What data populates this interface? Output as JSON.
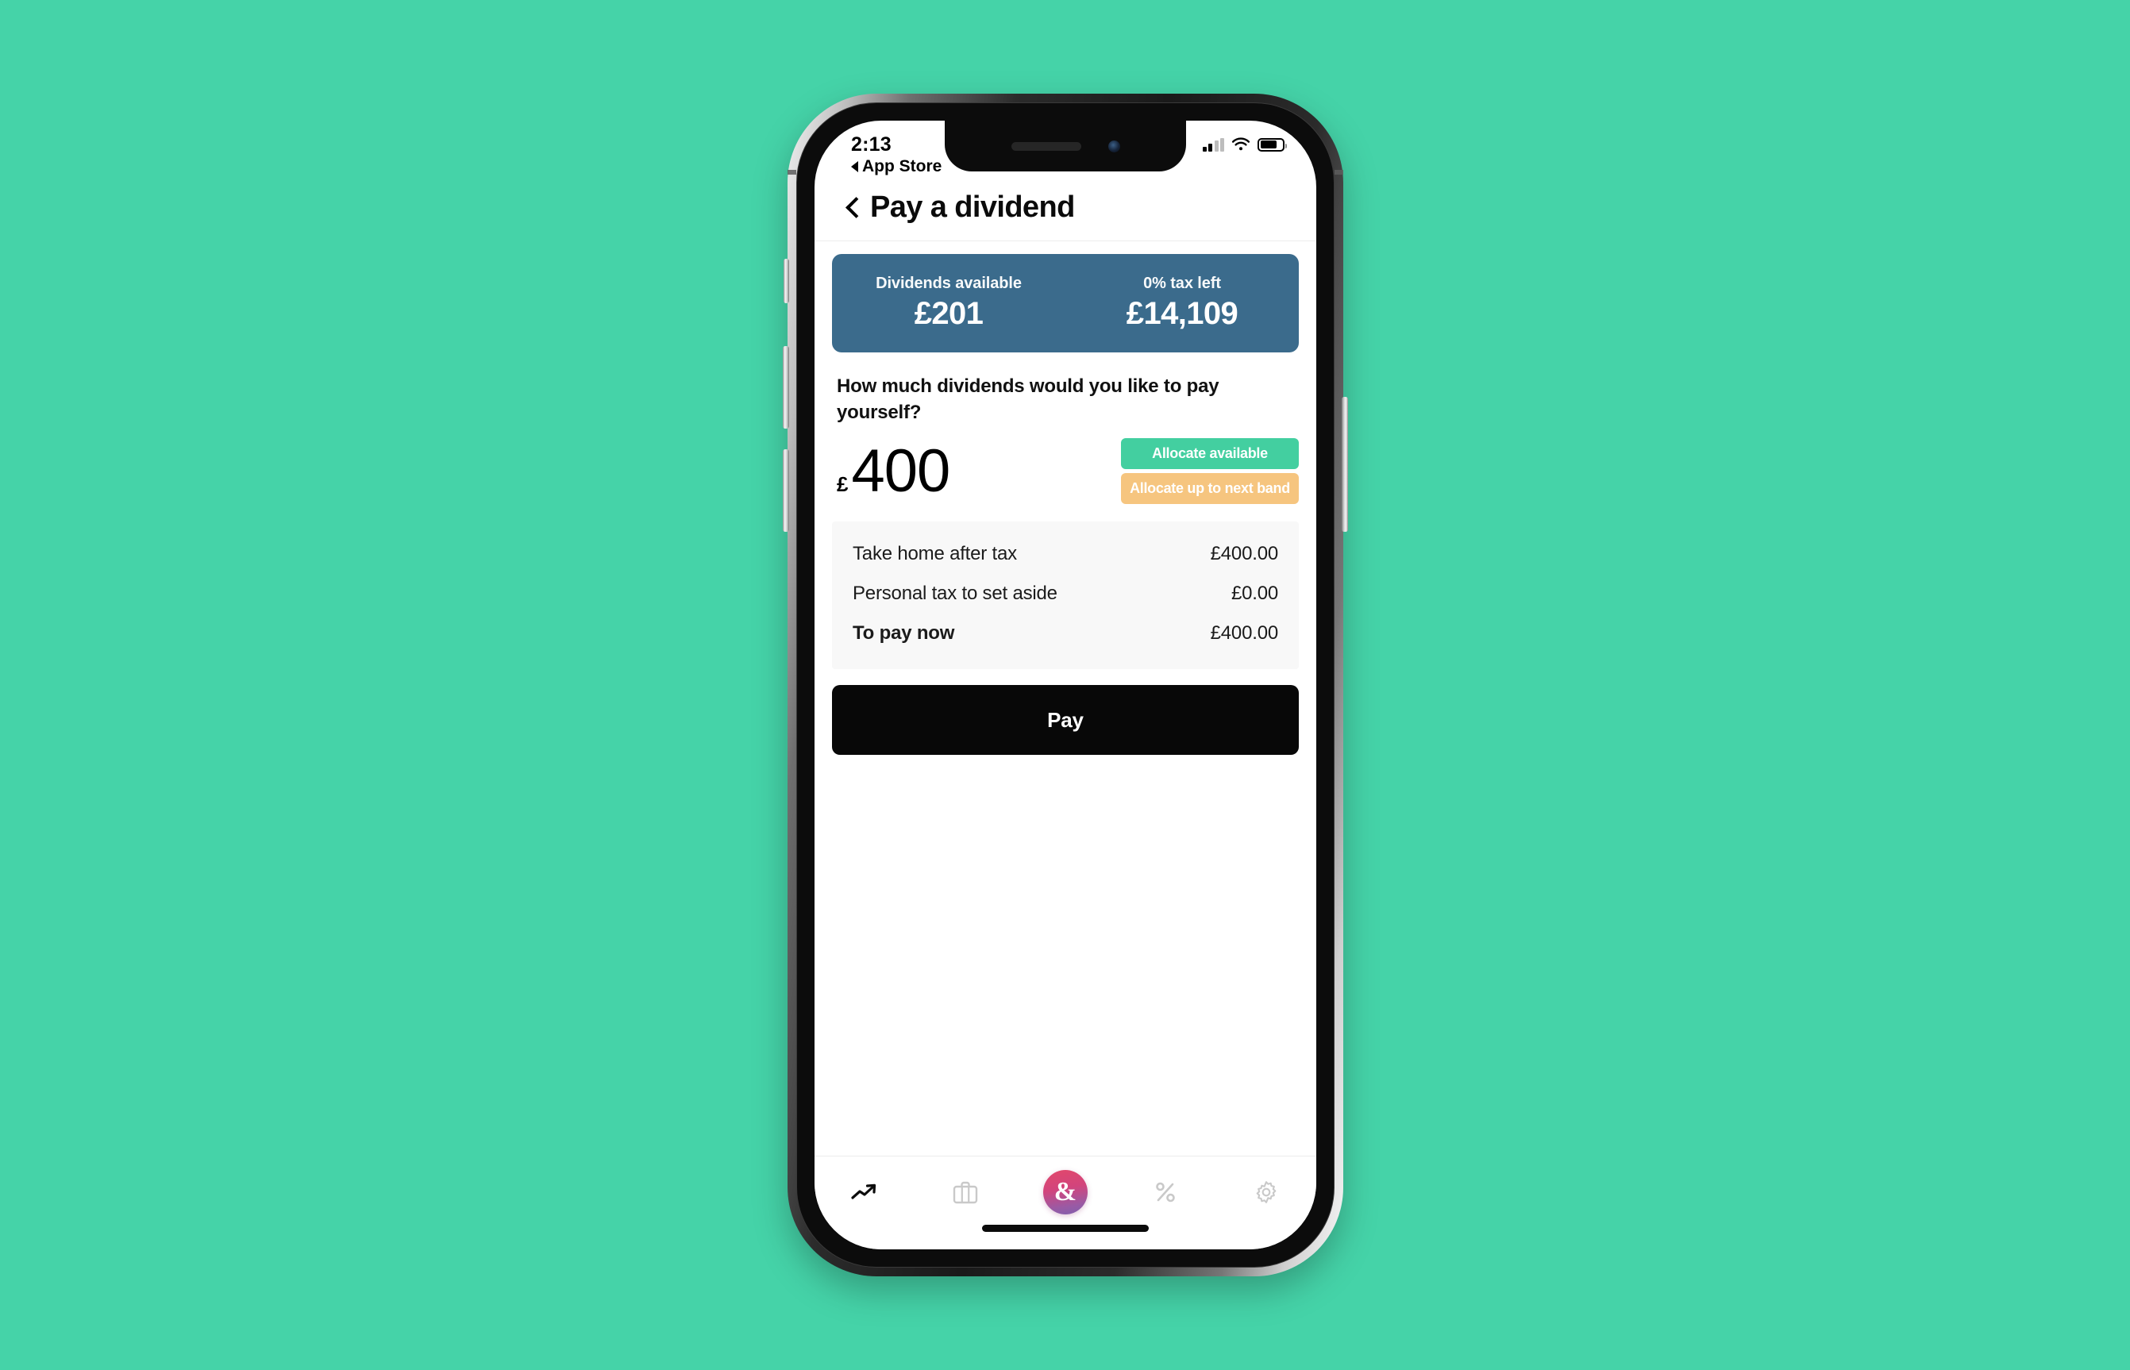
{
  "background_color": "#45d3a8",
  "device": {
    "name": "iphone-x",
    "buttons": [
      "silent-switch",
      "volume-up",
      "volume-down",
      "power-button"
    ]
  },
  "status_bar": {
    "time": "2:13",
    "back_to_app_label": "App Store",
    "signal_bars_filled": 2,
    "signal_bars_total": 4,
    "wifi": "wifi-icon",
    "battery_percent": 75
  },
  "nav": {
    "back_icon": "chevron-left-icon",
    "title": "Pay a dividend"
  },
  "summary_card": {
    "background_color": "#3b6b8c",
    "cells": [
      {
        "label": "Dividends available",
        "value": "£201"
      },
      {
        "label": "0% tax left",
        "value": "£14,109"
      }
    ]
  },
  "form": {
    "question": "How much dividends would you like to pay yourself?",
    "currency_symbol": "£",
    "amount_value": "400",
    "allocate_available_label": "Allocate available",
    "allocate_available_color": "#43cfa0",
    "allocate_next_band_label": "Allocate up to next band",
    "allocate_next_band_color": "#f6c57f"
  },
  "breakdown": {
    "rows": [
      {
        "label": "Take home after tax",
        "value": "£400.00"
      },
      {
        "label": "Personal tax to set aside",
        "value": "£0.00"
      },
      {
        "label": "To pay now",
        "value": "£400.00"
      }
    ]
  },
  "primary_action": {
    "label": "Pay",
    "color": "#080808"
  },
  "tab_bar": {
    "items": [
      {
        "name": "trending-up-icon",
        "active": true
      },
      {
        "name": "briefcase-icon",
        "active": false
      },
      {
        "name": "ampersand-icon",
        "active": false,
        "glyph": "&"
      },
      {
        "name": "percent-icon",
        "active": false
      },
      {
        "name": "gear-icon",
        "active": false
      }
    ]
  }
}
